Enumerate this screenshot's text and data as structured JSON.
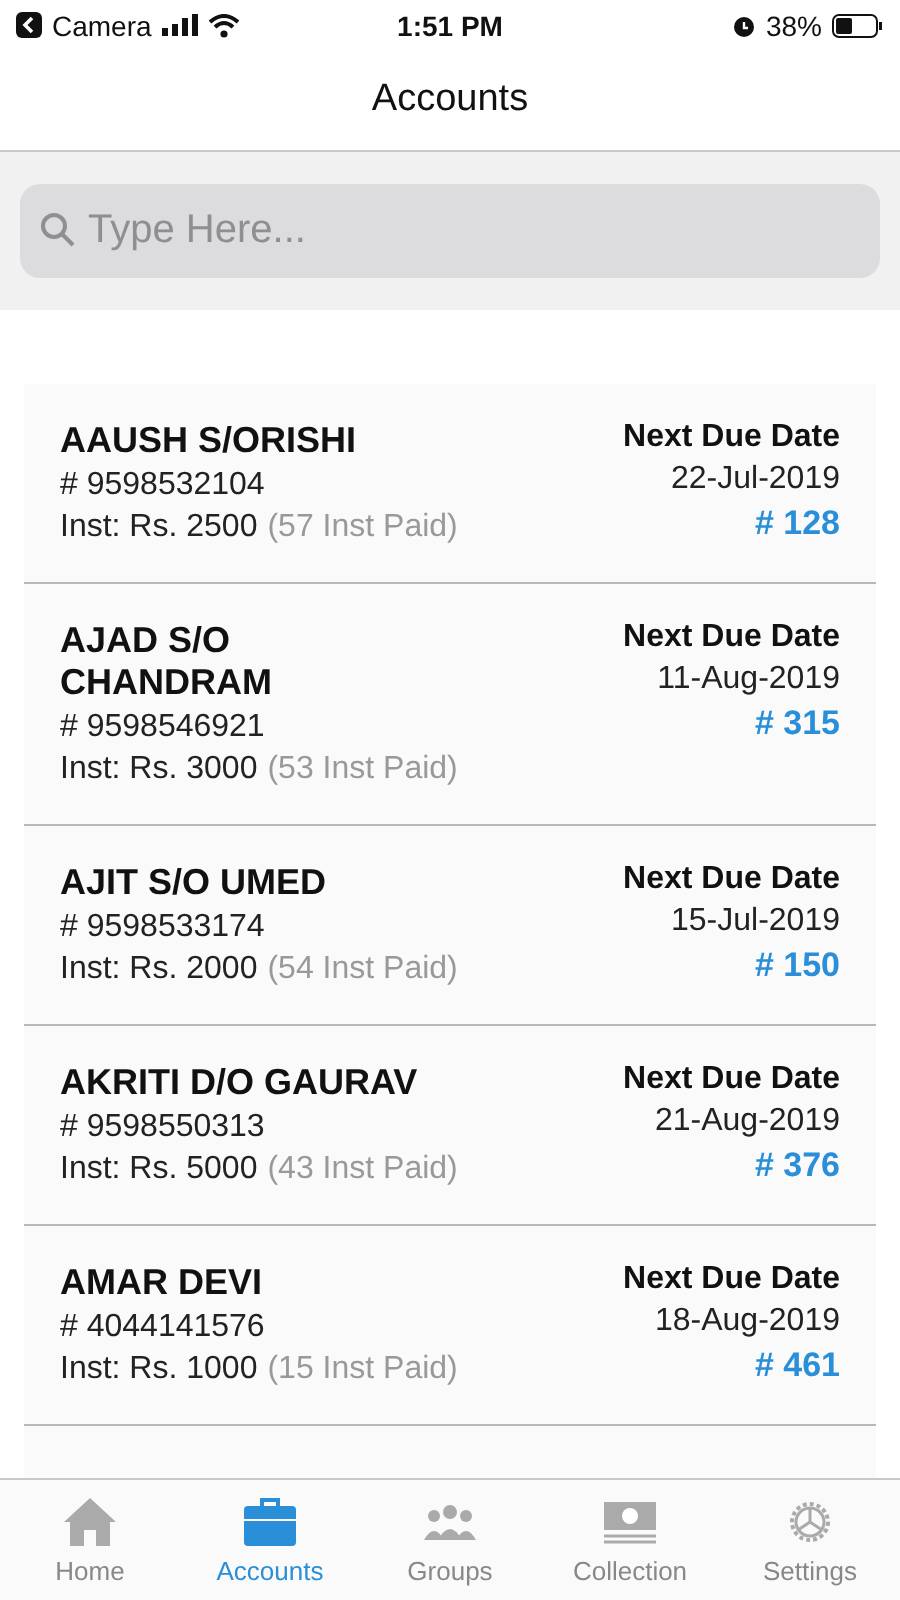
{
  "status_bar": {
    "back_label": "Camera",
    "time": "1:51 PM",
    "battery": "38%"
  },
  "nav": {
    "title": "Accounts"
  },
  "search": {
    "placeholder": "Type Here..."
  },
  "accounts": [
    {
      "name": "AAUSH S/ORISHI",
      "phone": "# 9598532104",
      "inst": "Inst: Rs. 2500",
      "paid": "(57 Inst Paid)",
      "due_label": "Next Due Date",
      "due_date": "22-Jul-2019",
      "number": "# 128"
    },
    {
      "name": "AJAD S/O CHANDRAM",
      "phone": "# 9598546921",
      "inst": "Inst: Rs. 3000",
      "paid": "(53 Inst Paid)",
      "due_label": "Next Due Date",
      "due_date": "11-Aug-2019",
      "number": "# 315"
    },
    {
      "name": "AJIT S/O UMED",
      "phone": "# 9598533174",
      "inst": "Inst: Rs. 2000",
      "paid": "(54 Inst Paid)",
      "due_label": "Next Due Date",
      "due_date": "15-Jul-2019",
      "number": "# 150"
    },
    {
      "name": "AKRITI D/O GAURAV",
      "phone": "# 9598550313",
      "inst": "Inst: Rs. 5000",
      "paid": "(43 Inst Paid)",
      "due_label": "Next Due Date",
      "due_date": "21-Aug-2019",
      "number": "# 376"
    },
    {
      "name": "AMAR DEVI",
      "phone": "# 4044141576",
      "inst": "Inst: Rs. 1000",
      "paid": "(15 Inst Paid)",
      "due_label": "Next Due Date",
      "due_date": "18-Aug-2019",
      "number": "# 461"
    }
  ],
  "tabs": [
    {
      "label": "Home",
      "kind": "home",
      "selected": false
    },
    {
      "label": "Accounts",
      "kind": "briefcase",
      "selected": true
    },
    {
      "label": "Groups",
      "kind": "people",
      "selected": false
    },
    {
      "label": "Collection",
      "kind": "money",
      "selected": false
    },
    {
      "label": "Settings",
      "kind": "gear",
      "selected": false
    }
  ]
}
